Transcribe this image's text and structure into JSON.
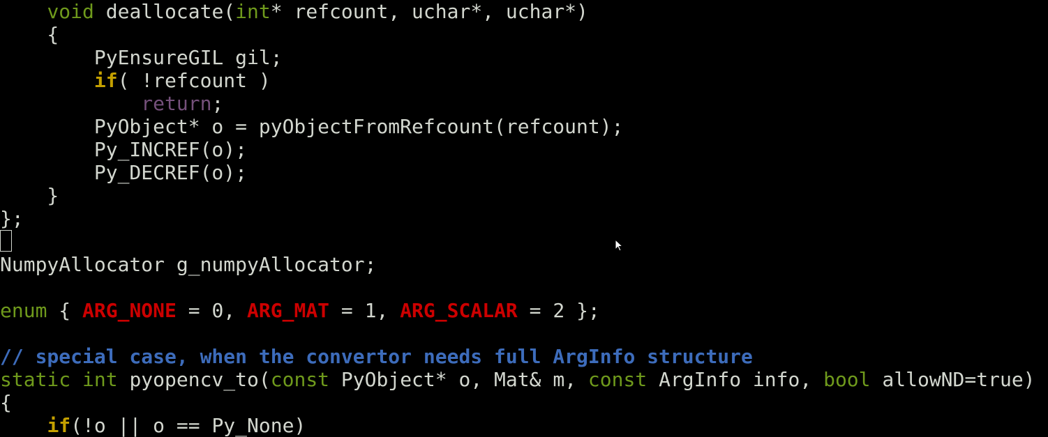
{
  "editor": {
    "lines": [
      [
        {
          "text": "    "
        },
        {
          "text": "void",
          "cls": "kw-green"
        },
        {
          "text": " deallocate("
        },
        {
          "text": "int",
          "cls": "kw-green"
        },
        {
          "text": "* refcount, uchar*, uchar*)"
        }
      ],
      [
        {
          "text": "    {"
        }
      ],
      [
        {
          "text": "        PyEnsureGIL gil;"
        }
      ],
      [
        {
          "text": "        "
        },
        {
          "text": "if",
          "cls": "kw-yellow"
        },
        {
          "text": "( !refcount )"
        }
      ],
      [
        {
          "text": "            "
        },
        {
          "text": "return",
          "cls": "kw-purple"
        },
        {
          "text": ";"
        }
      ],
      [
        {
          "text": "        PyObject* o = pyObjectFromRefcount(refcount);"
        }
      ],
      [
        {
          "text": "        Py_INCREF(o);"
        }
      ],
      [
        {
          "text": "        Py_DECREF(o);"
        }
      ],
      [
        {
          "text": "    }"
        }
      ],
      [
        {
          "text": "};"
        }
      ],
      [
        {
          "text": ""
        }
      ],
      [
        {
          "text": "NumpyAllocator g_numpyAllocator;"
        }
      ],
      [
        {
          "text": ""
        }
      ],
      [
        {
          "text": "enum",
          "cls": "kw-green"
        },
        {
          "text": " { "
        },
        {
          "text": "ARG_NONE",
          "cls": "const-red"
        },
        {
          "text": " = 0, "
        },
        {
          "text": "ARG_MAT",
          "cls": "const-red"
        },
        {
          "text": " = 1, "
        },
        {
          "text": "ARG_SCALAR",
          "cls": "const-red"
        },
        {
          "text": " = 2 };"
        }
      ],
      [
        {
          "text": ""
        }
      ],
      [
        {
          "text": "// special case, when the convertor needs full ArgInfo structure",
          "cls": "comment"
        }
      ],
      [
        {
          "text": "static",
          "cls": "kw-green"
        },
        {
          "text": " "
        },
        {
          "text": "int",
          "cls": "kw-green"
        },
        {
          "text": " pyopencv_to("
        },
        {
          "text": "const",
          "cls": "kw-green"
        },
        {
          "text": " PyObject* o, Mat& m, "
        },
        {
          "text": "const",
          "cls": "kw-green"
        },
        {
          "text": " ArgInfo info, "
        },
        {
          "text": "bool",
          "cls": "kw-green"
        },
        {
          "text": " allowND=true)"
        }
      ],
      [
        {
          "text": "{"
        }
      ],
      [
        {
          "text": "    "
        },
        {
          "text": "if",
          "cls": "kw-yellow"
        },
        {
          "text": "(!o || o == Py_None)"
        }
      ]
    ]
  },
  "colors": {
    "background": "#000000",
    "text": "#d3d7cf",
    "type_keyword": "#6f9a1c",
    "control_keyword": "#c4a000",
    "return_keyword": "#75507b",
    "enum_constant": "#cc0000",
    "comment": "#3d6cbb"
  },
  "icons": {
    "cursor": "text-cursor-block",
    "pointer": "mouse-pointer-icon"
  }
}
